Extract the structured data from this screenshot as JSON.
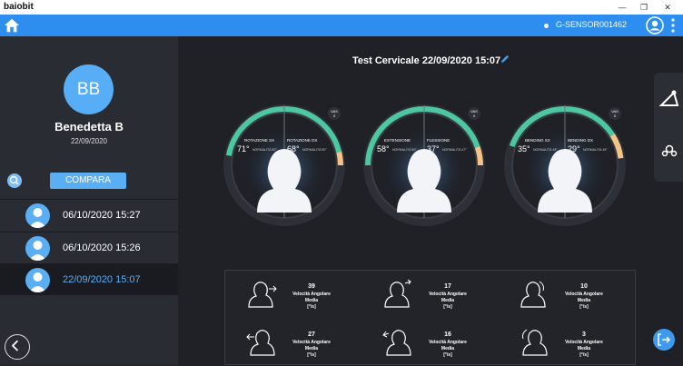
{
  "titlebar": {
    "app_name": "baiobit"
  },
  "topbar": {
    "device_label": "G-SENSOR001462"
  },
  "patient": {
    "initials": "BB",
    "name": "Benedetta B",
    "date": "22/09/2020"
  },
  "compare_label": "COMPARA",
  "sessions": [
    {
      "label": "06/10/2020 15:27",
      "active": false
    },
    {
      "label": "06/10/2020 15:26",
      "active": false
    },
    {
      "label": "22/09/2020 15:07",
      "active": true
    }
  ],
  "test_title": "Test Cervicale 22/09/2020 15:07",
  "gauges": [
    {
      "left_label": "ROTAZIONE SX",
      "right_label": "ROTAZIONE DX",
      "left_value": "71°",
      "right_value": "68°",
      "left_norm": "NORMALITÀ 80°",
      "right_norm": "NORMALITÀ 80°",
      "vas_label": "VAS",
      "vas_value": "0",
      "left_fraction": 0.89,
      "right_fraction": 0.85
    },
    {
      "left_label": "ESTENSIONE",
      "right_label": "FLESSIONE",
      "left_value": "58°",
      "right_value": "37°",
      "left_norm": "NORMALITÀ 50°",
      "right_norm": "NORMALITÀ 47°",
      "vas_label": "VAS",
      "vas_value": "0",
      "left_fraction": 1.0,
      "right_fraction": 0.79
    },
    {
      "left_label": "BENDING SX",
      "right_label": "BENDING DX",
      "left_value": "35°",
      "right_value": "29°",
      "left_norm": "NORMALITÀ 45°",
      "right_norm": "NORMALITÀ 45°",
      "vas_label": "VAS",
      "vas_value": "0",
      "left_fraction": 0.78,
      "right_fraction": 0.64
    }
  ],
  "colors": {
    "accent": "#2d8ef0",
    "good": "#4cc7a0",
    "warn": "#f5c287",
    "track": "#3a3c44"
  },
  "stats": [
    {
      "value": "39",
      "label_line1": "Velocità Angolare",
      "label_line2": "Media",
      "label_line3": "[°/s]",
      "icon": "head-rotation-icon"
    },
    {
      "value": "17",
      "label_line1": "Velocità Angolare",
      "label_line2": "Media",
      "label_line3": "[°/s]",
      "icon": "head-extension-icon"
    },
    {
      "value": "10",
      "label_line1": "Velocità Angolare",
      "label_line2": "Media",
      "label_line3": "[°/s]",
      "icon": "head-bending-icon"
    },
    {
      "value": "27",
      "label_line1": "Velocità Angolare",
      "label_line2": "Media",
      "label_line3": "[°/s]",
      "icon": "head-rotation-icon"
    },
    {
      "value": "16",
      "label_line1": "Velocità Angolare",
      "label_line2": "Media",
      "label_line3": "[°/s]",
      "icon": "head-flexion-icon"
    },
    {
      "value": "3",
      "label_line1": "Velocità Angolare",
      "label_line2": "Media",
      "label_line3": "[°/s]",
      "icon": "head-bending-icon"
    }
  ]
}
